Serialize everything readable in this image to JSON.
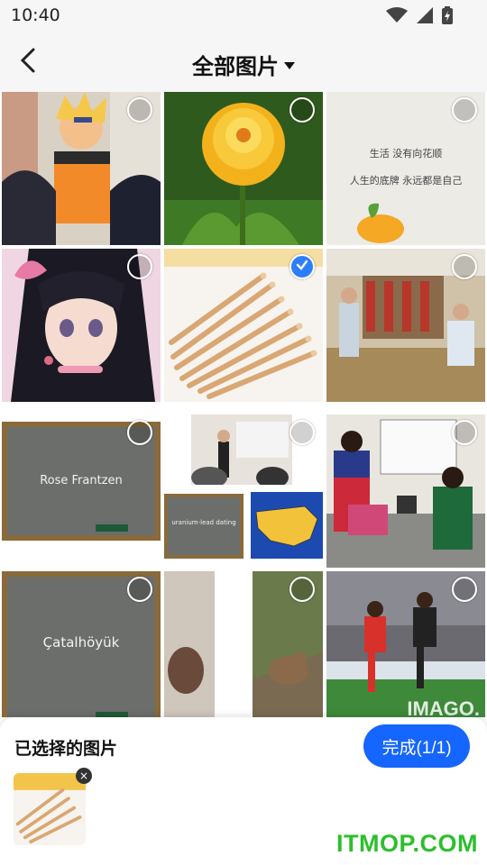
{
  "status": {
    "time": "10:40"
  },
  "header": {
    "title": "全部图片"
  },
  "photos": [
    {
      "id": "anime-group",
      "selected": false
    },
    {
      "id": "yellow-flower",
      "selected": false
    },
    {
      "id": "quote-card",
      "selected": false,
      "quote_line1": "生活 没有向花顺",
      "quote_line2": "人生的底牌 永远都是自己"
    },
    {
      "id": "anime-girl",
      "selected": false
    },
    {
      "id": "wooden-sticks",
      "selected": true
    },
    {
      "id": "library-meeting",
      "selected": false
    },
    {
      "id": "chalkboard-name",
      "selected": false,
      "board_text": "Rose Frantzen"
    },
    {
      "id": "collage-lecture",
      "selected": false,
      "board_text": "uranium-lead dating"
    },
    {
      "id": "office-scene",
      "selected": false
    },
    {
      "id": "chalkboard-place",
      "selected": false,
      "board_text": "Çatalhöyük"
    },
    {
      "id": "collage-animal",
      "selected": false
    },
    {
      "id": "soccer-match",
      "selected": false,
      "overlay_text": "IMAGO."
    }
  ],
  "panel": {
    "title": "已选择的图片",
    "done_label": "完成(1/1)",
    "remove_label": "×"
  },
  "watermark": "ITMOP.COM",
  "colors": {
    "accent": "#1565ff",
    "check": "#2d7ff9",
    "watermark": "#2cbf2c"
  }
}
